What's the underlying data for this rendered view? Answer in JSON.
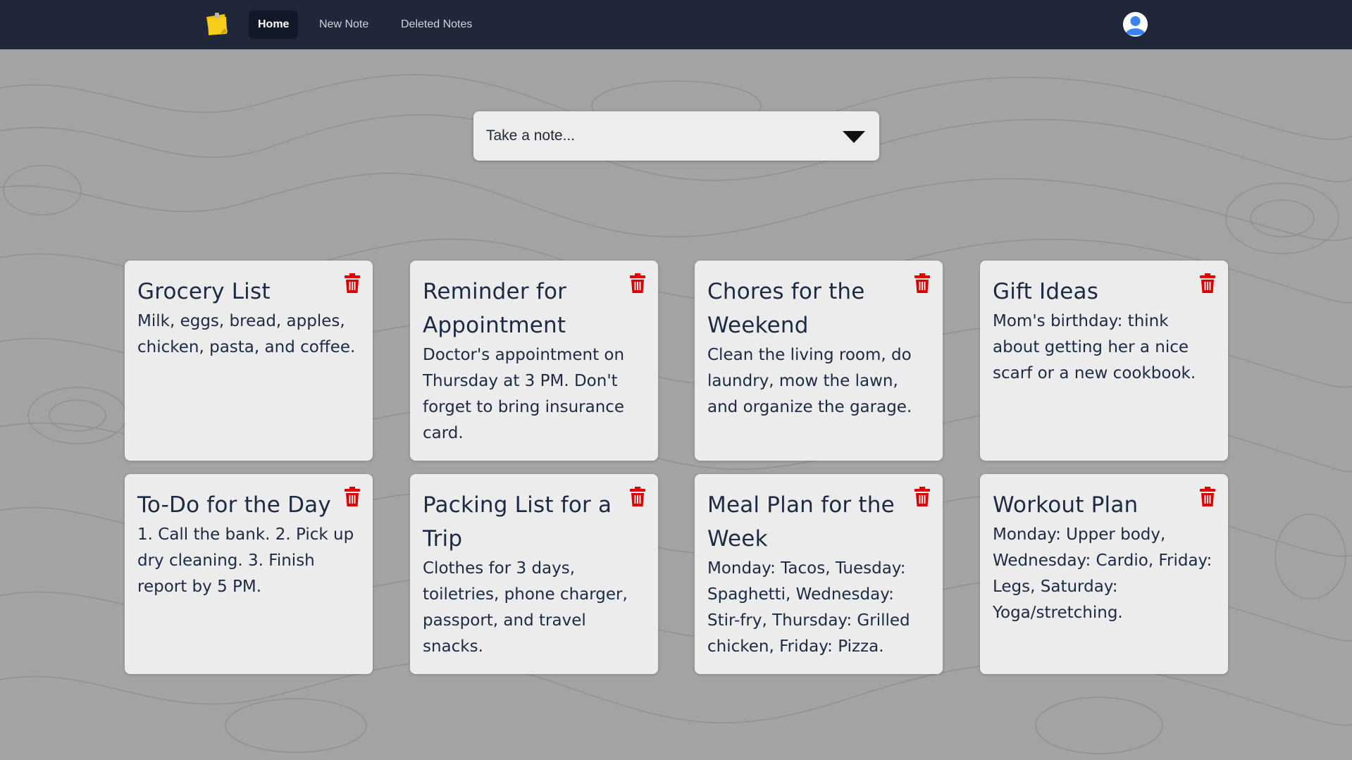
{
  "nav": {
    "logo_icon": "sticky-note-logo-icon",
    "links": [
      {
        "label": "Home",
        "active": true
      },
      {
        "label": "New Note",
        "active": false
      },
      {
        "label": "Deleted Notes",
        "active": false
      }
    ],
    "avatar_icon": "user-avatar-icon"
  },
  "composer": {
    "placeholder": "Take a note...",
    "toggle_icon": "triangle-down-icon"
  },
  "colors": {
    "navbar": "#1f2739",
    "card": "#ececec",
    "text": "#1c2a44",
    "trash": "#e00000"
  },
  "notes": [
    {
      "title": "Grocery List",
      "body": "Milk, eggs, bread, apples, chicken, pasta, and coffee."
    },
    {
      "title": "Reminder for Appointment",
      "body": "Doctor's appointment on Thursday at 3 PM. Don't forget to bring insurance card."
    },
    {
      "title": "Chores for the Weekend",
      "body": "Clean the living room, do laundry, mow the lawn, and organize the garage."
    },
    {
      "title": "Gift Ideas",
      "body": "Mom's birthday: think about getting her a nice scarf or a new cookbook."
    },
    {
      "title": "To-Do for the Day",
      "body": "1. Call the bank. 2. Pick up dry cleaning. 3. Finish report by 5 PM."
    },
    {
      "title": "Packing List for a Trip",
      "body": "Clothes for 3 days, toiletries, phone charger, passport, and travel snacks."
    },
    {
      "title": "Meal Plan for the Week",
      "body": "Monday: Tacos, Tuesday: Spaghetti, Wednesday: Stir-fry, Thursday: Grilled chicken, Friday: Pizza."
    },
    {
      "title": "Workout Plan",
      "body": "Monday: Upper body, Wednesday: Cardio, Friday: Legs, Saturday: Yoga/stretching."
    }
  ]
}
